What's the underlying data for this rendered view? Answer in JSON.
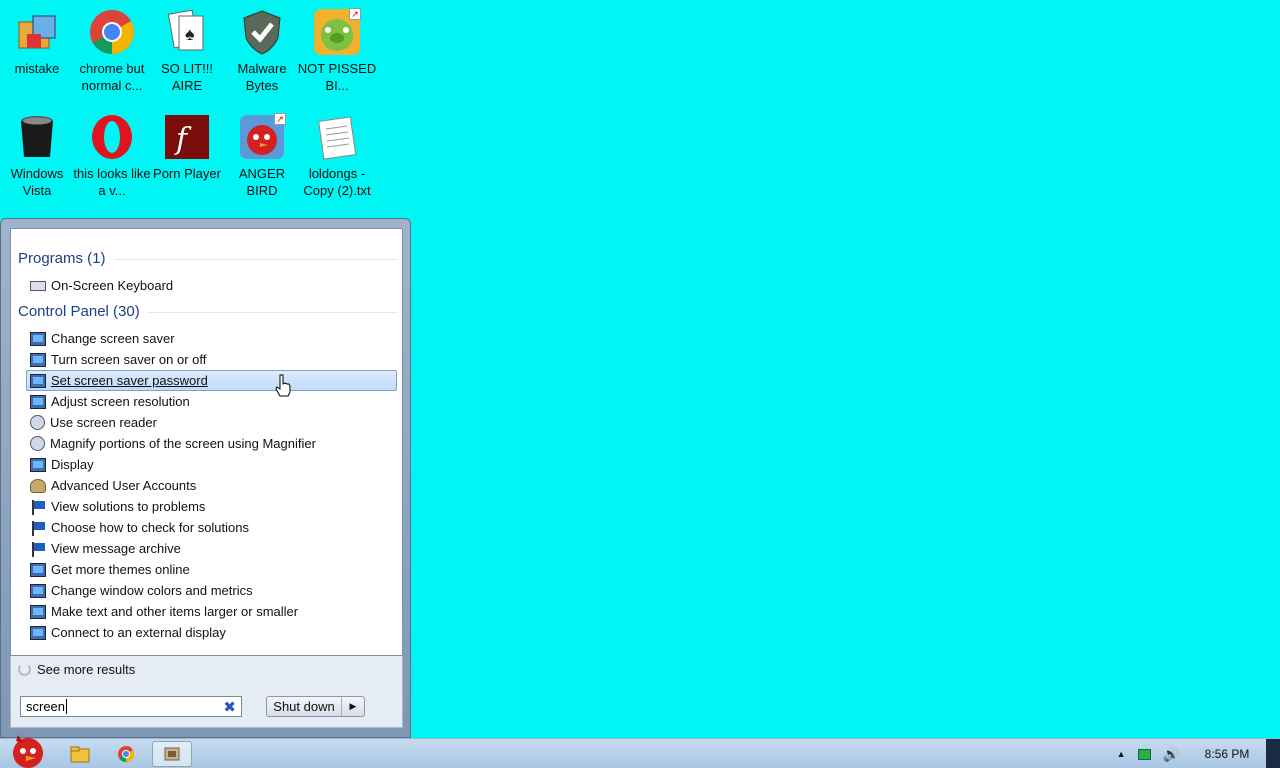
{
  "desktop": {
    "icons": [
      {
        "label": "mistake"
      },
      {
        "label": "chrome but normal c..."
      },
      {
        "label": "SO LIT!!! AIRE"
      },
      {
        "label": "Malware Bytes"
      },
      {
        "label": "NOT PISSED BI..."
      },
      {
        "label": "Windows Vista"
      },
      {
        "label": "this looks like a v..."
      },
      {
        "label": "Porn Player"
      },
      {
        "label": "ANGER BIRD"
      },
      {
        "label": "loldongs - Copy (2).txt"
      }
    ]
  },
  "start_menu": {
    "programs_header": "Programs (1)",
    "programs": [
      {
        "label": "On-Screen Keyboard",
        "icon": "keyboard-icon"
      }
    ],
    "control_panel_header": "Control Panel (30)",
    "control_panel": [
      {
        "label": "Change screen saver",
        "icon": "monitor-icon"
      },
      {
        "label": "Turn screen saver on or off",
        "icon": "monitor-icon"
      },
      {
        "label": "Set screen saver password",
        "icon": "monitor-icon",
        "selected": true
      },
      {
        "label": "Adjust screen resolution",
        "icon": "monitor-icon"
      },
      {
        "label": "Use screen reader",
        "icon": "magnifier-icon"
      },
      {
        "label": "Magnify portions of the screen using Magnifier",
        "icon": "magnifier-icon"
      },
      {
        "label": "Display",
        "icon": "monitor-icon"
      },
      {
        "label": "Advanced User Accounts",
        "icon": "users-icon"
      },
      {
        "label": "View solutions to problems",
        "icon": "flag-icon"
      },
      {
        "label": "Choose how to check for solutions",
        "icon": "flag-icon"
      },
      {
        "label": "View message archive",
        "icon": "flag-icon"
      },
      {
        "label": "Get more themes online",
        "icon": "monitor-icon"
      },
      {
        "label": "Change window colors and metrics",
        "icon": "monitor-icon"
      },
      {
        "label": "Make text and other items larger or smaller",
        "icon": "monitor-icon"
      },
      {
        "label": "Connect to an external display",
        "icon": "monitor-icon"
      }
    ],
    "see_more": "See more results",
    "search_value": "screen",
    "shut_down": "Shut down"
  },
  "taskbar": {
    "clock": "8:56 PM"
  }
}
